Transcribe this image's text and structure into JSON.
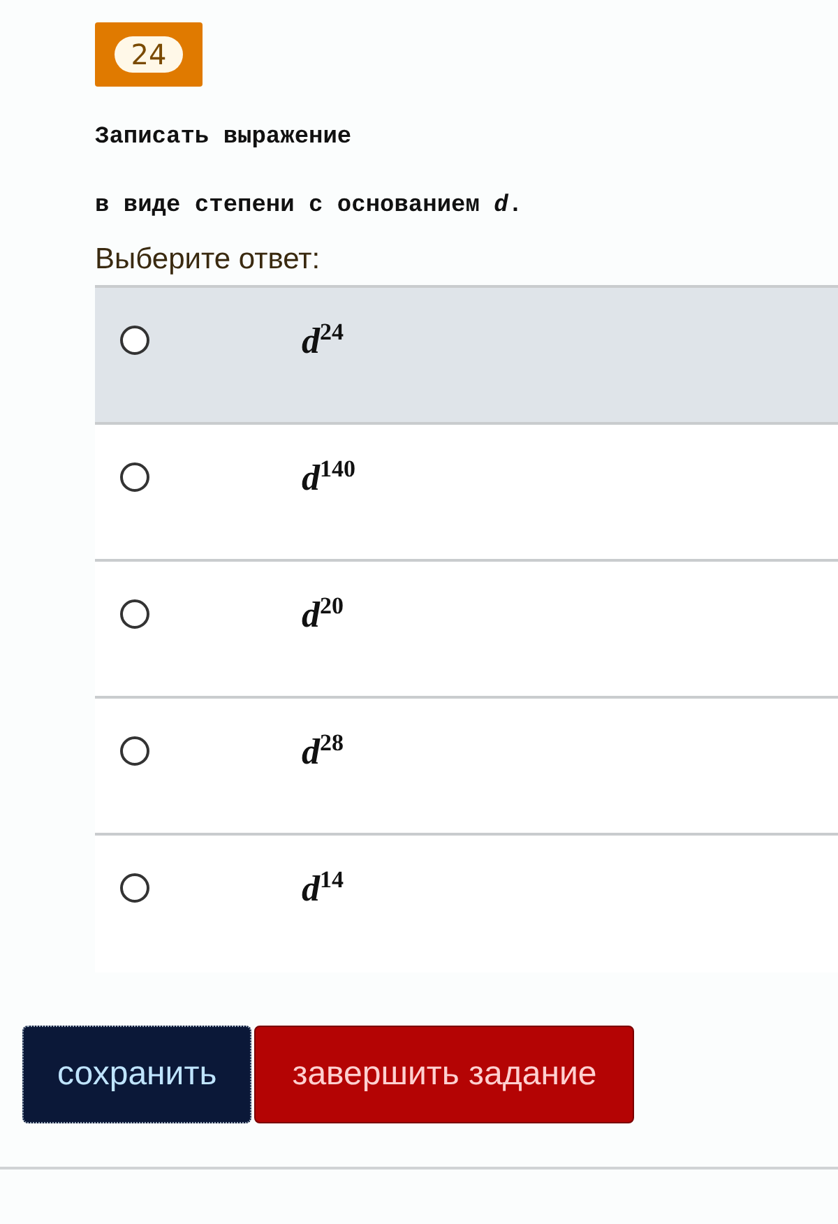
{
  "question": {
    "number": "24",
    "lines": [
      "Записать выражение",
      "в виде степени с основанием *d*."
    ]
  },
  "prompt": "Выберите ответ:",
  "options": [
    {
      "base": "d",
      "exponent": "24",
      "selected": false,
      "highlighted": true
    },
    {
      "base": "d",
      "exponent": "140",
      "selected": false,
      "highlighted": false
    },
    {
      "base": "d",
      "exponent": "20",
      "selected": false,
      "highlighted": false
    },
    {
      "base": "d",
      "exponent": "28",
      "selected": false,
      "highlighted": false
    },
    {
      "base": "d",
      "exponent": "14",
      "selected": false,
      "highlighted": false
    }
  ],
  "buttons": [
    {
      "kind": "save",
      "label": "сохранить"
    },
    {
      "kind": "finish",
      "label": "завершить задание"
    }
  ]
}
